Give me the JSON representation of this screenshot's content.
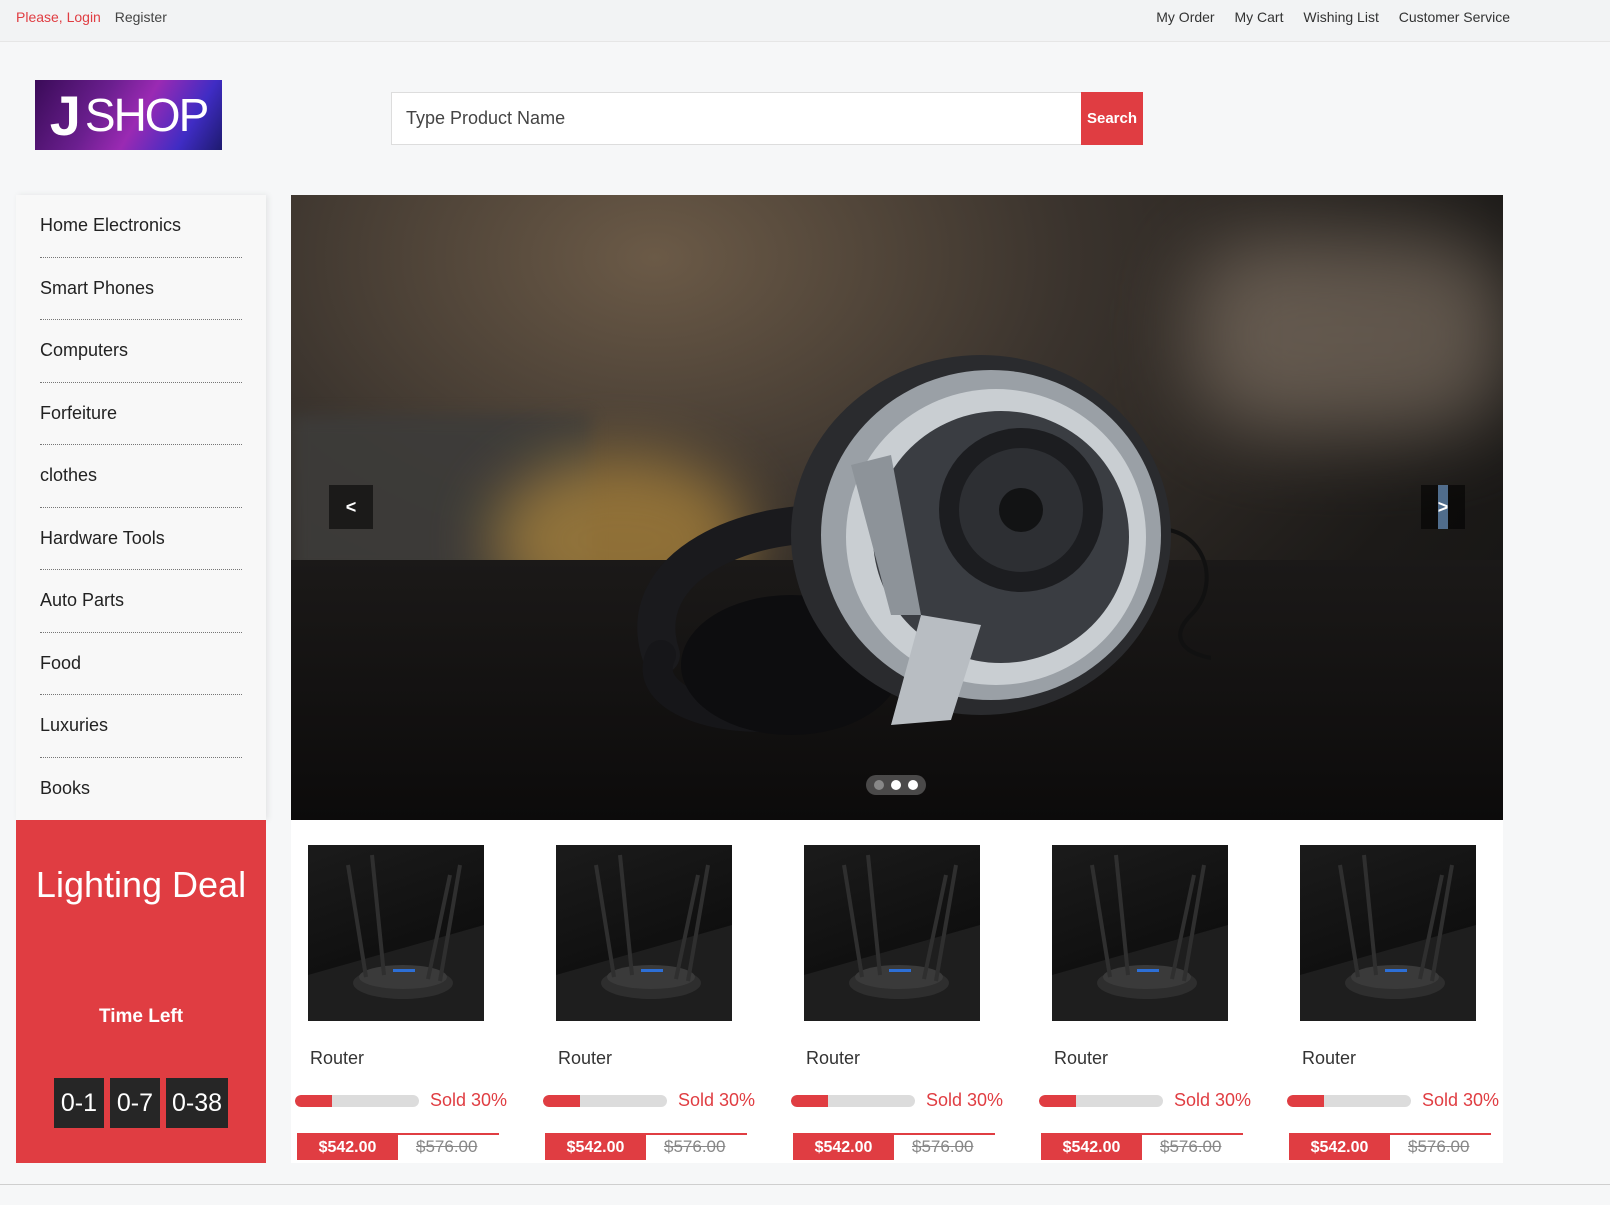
{
  "topbar": {
    "login": "Please, Login",
    "register": "Register",
    "links": [
      "My Order",
      "My Cart",
      "Wishing List",
      "Customer Service"
    ]
  },
  "header": {
    "logo_text_j": "J",
    "logo_text_shop": "SHOP",
    "search_placeholder": "Type Product Name",
    "search_button": "Search"
  },
  "sidebar": {
    "items": [
      "Home Electronics",
      "Smart Phones",
      "Computers",
      "Forfeiture",
      "clothes",
      "Hardware Tools",
      "Auto Parts",
      "Food",
      "Luxuries",
      "Books"
    ]
  },
  "carousel": {
    "prev_label": "<",
    "next_label": ">",
    "slides": 3,
    "active_slide": 1
  },
  "deal": {
    "title": "Lighting Deal",
    "time_left_label": "Time Left",
    "timer": [
      "0-1",
      "0-7",
      "0-38"
    ]
  },
  "products": [
    {
      "name": "Router",
      "sold_label": "Sold 30%",
      "sold_fraction": 0.3,
      "price": "$542.00",
      "old_price": "$576.00"
    },
    {
      "name": "Router",
      "sold_label": "Sold 30%",
      "sold_fraction": 0.3,
      "price": "$542.00",
      "old_price": "$576.00"
    },
    {
      "name": "Router",
      "sold_label": "Sold 30%",
      "sold_fraction": 0.3,
      "price": "$542.00",
      "old_price": "$576.00"
    },
    {
      "name": "Router",
      "sold_label": "Sold 30%",
      "sold_fraction": 0.3,
      "price": "$542.00",
      "old_price": "$576.00"
    },
    {
      "name": "Router",
      "sold_label": "Sold 30%",
      "sold_fraction": 0.3,
      "price": "$542.00",
      "old_price": "$576.00"
    }
  ],
  "colors": {
    "accent": "#e03d42",
    "timer_bg": "#262626"
  }
}
